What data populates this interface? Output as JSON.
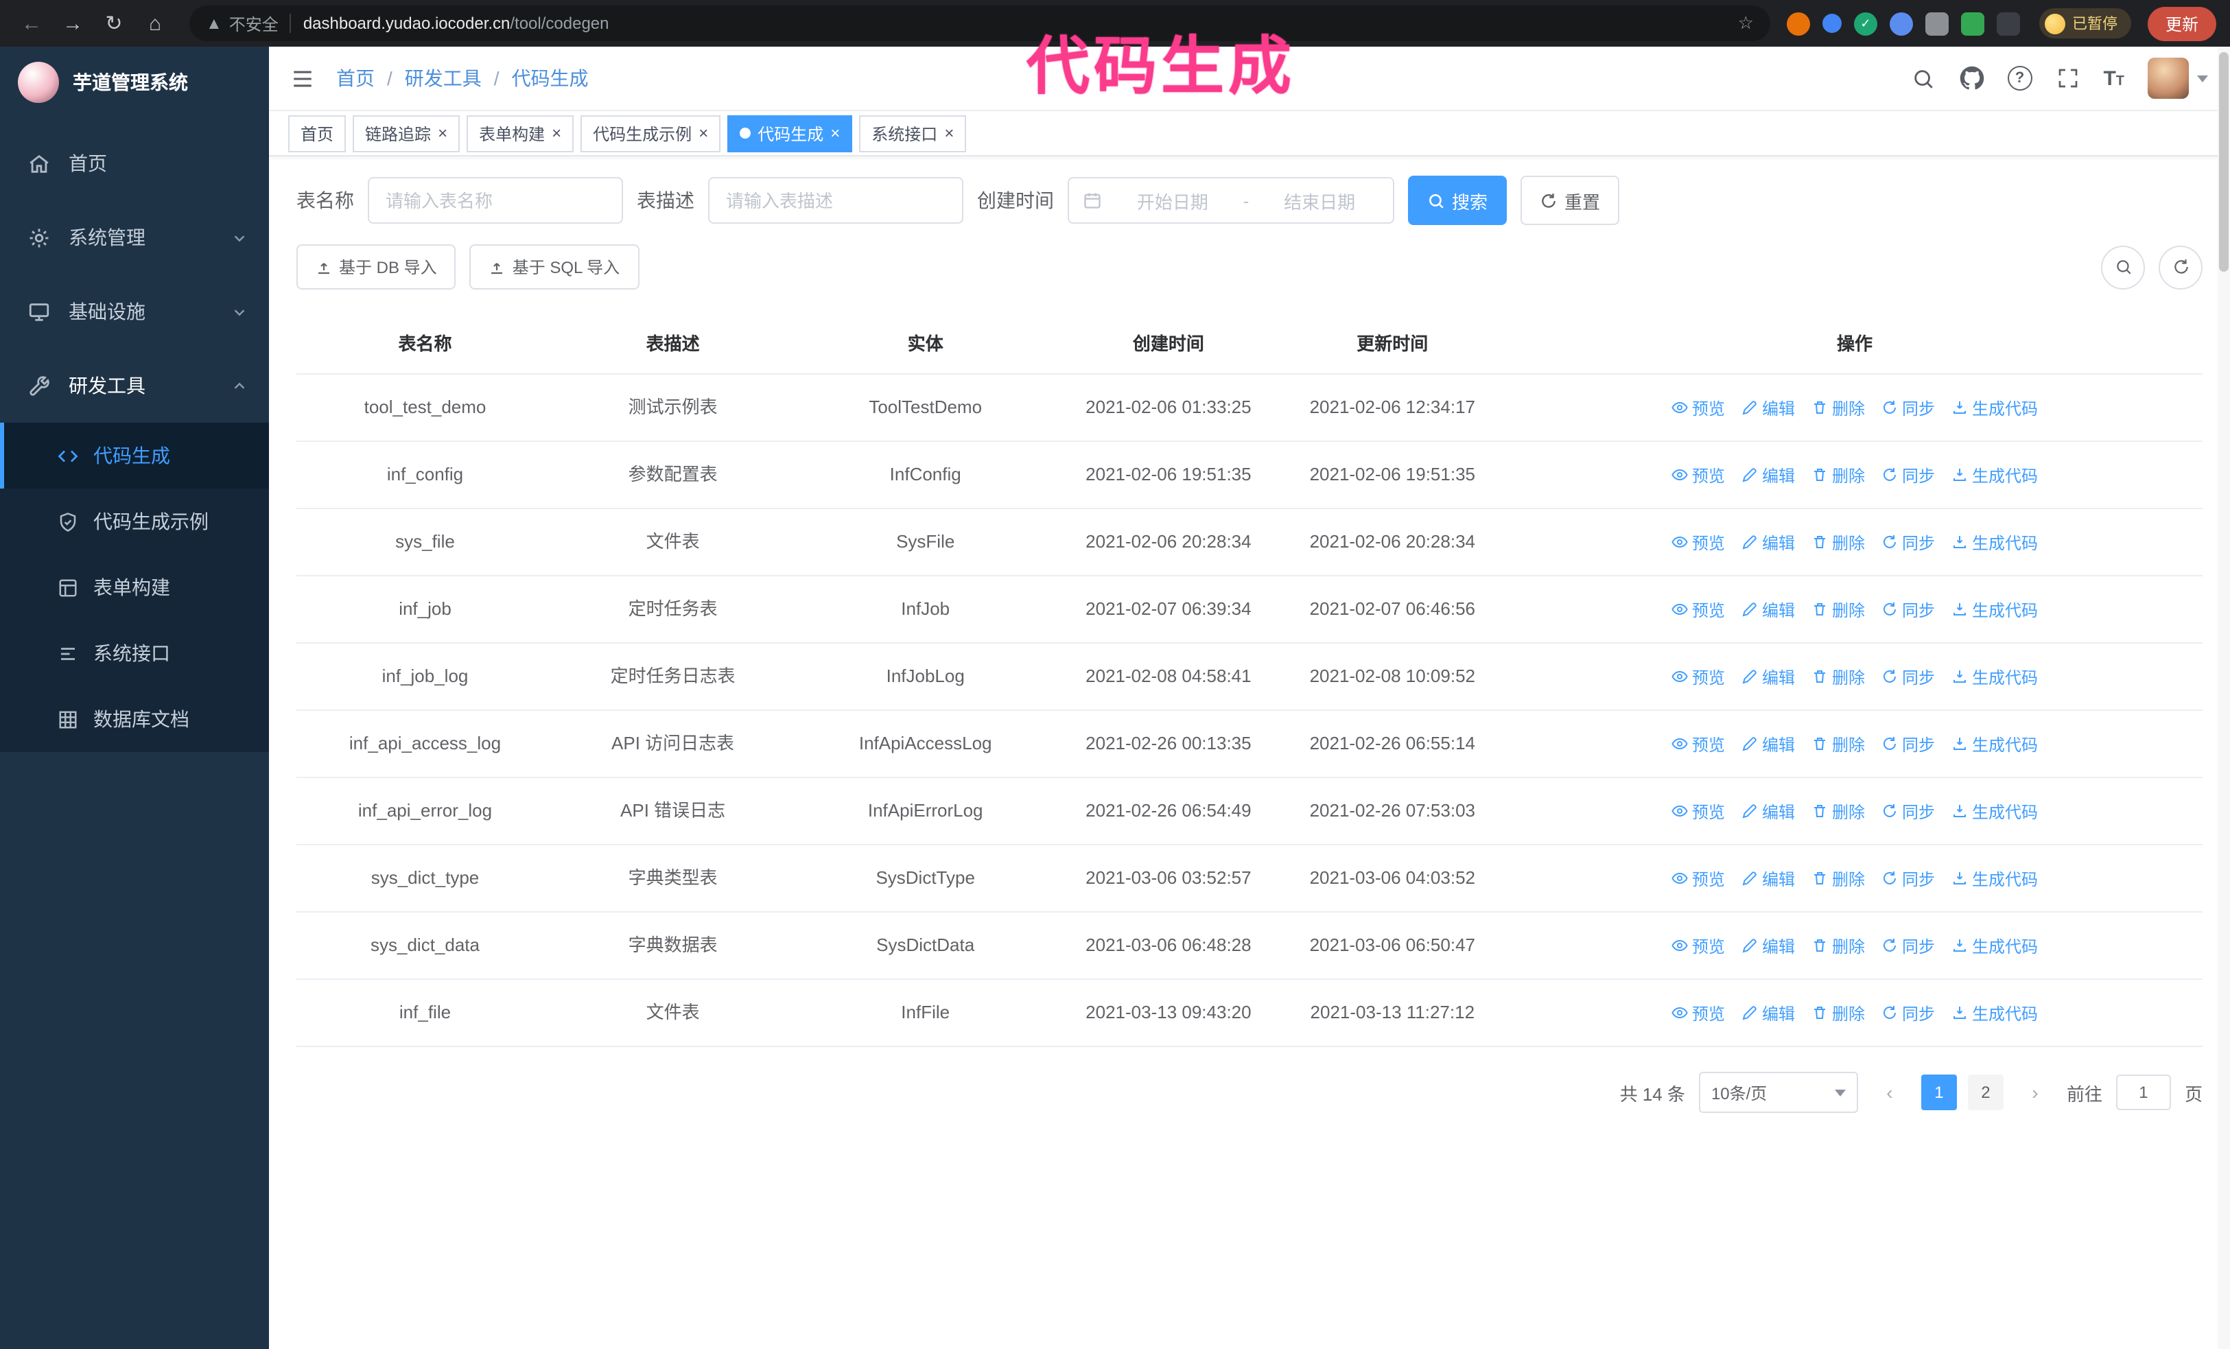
{
  "theme": {
    "accent": "#409eff",
    "sidebar_bg": "#1f3347",
    "submenu_bg": "#152638",
    "annotation_pink": "#fb3b8c"
  },
  "browser": {
    "security_label": "不安全",
    "url_host": "dashboard.yudao.iocoder.cn",
    "url_path": "/tool/codegen",
    "paused_badge": "已暂停",
    "update_button": "更新",
    "extensions": [
      "fox",
      "drop",
      "check",
      "people",
      "camera",
      "leaf",
      "puzzle"
    ]
  },
  "annotation": {
    "title": "代码生成",
    "color": "#fb3b8c"
  },
  "sidebar": {
    "logo_title": "芋道管理系统",
    "items": [
      {
        "label": "首页",
        "icon": "home-icon"
      },
      {
        "label": "系统管理",
        "icon": "gear-icon"
      },
      {
        "label": "基础设施",
        "icon": "monitor-icon"
      },
      {
        "label": "研发工具",
        "icon": "wrench-icon"
      }
    ],
    "sub_items": [
      {
        "label": "代码生成",
        "icon": "code-icon",
        "active": true
      },
      {
        "label": "代码生成示例",
        "icon": "shield-icon"
      },
      {
        "label": "表单构建",
        "icon": "form-icon"
      },
      {
        "label": "系统接口",
        "icon": "list-icon"
      },
      {
        "label": "数据库文档",
        "icon": "grid-icon"
      }
    ]
  },
  "breadcrumb": {
    "items": [
      "首页",
      "研发工具",
      "代码生成"
    ],
    "separator": "/"
  },
  "navbar_icons": [
    "search",
    "github",
    "help",
    "fullscreen",
    "font-size",
    "avatar"
  ],
  "tags": [
    {
      "label": "首页",
      "closable": false,
      "active": false
    },
    {
      "label": "链路追踪",
      "closable": true,
      "active": false
    },
    {
      "label": "表单构建",
      "closable": true,
      "active": false
    },
    {
      "label": "代码生成示例",
      "closable": true,
      "active": false
    },
    {
      "label": "代码生成",
      "closable": true,
      "active": true
    },
    {
      "label": "系统接口",
      "closable": true,
      "active": false
    }
  ],
  "filters": {
    "table_name_label": "表名称",
    "table_name_placeholder": "请输入表名称",
    "table_desc_label": "表描述",
    "table_desc_placeholder": "请输入表描述",
    "create_time_label": "创建时间",
    "date_start_placeholder": "开始日期",
    "date_separator": "-",
    "date_end_placeholder": "结束日期",
    "search_button": "搜索",
    "reset_button": "重置"
  },
  "toolbar": {
    "import_db_button": "基于 DB 导入",
    "import_sql_button": "基于 SQL 导入"
  },
  "table": {
    "columns": [
      "表名称",
      "表描述",
      "实体",
      "创建时间",
      "更新时间",
      "操作"
    ],
    "actions": [
      {
        "label": "预览"
      },
      {
        "label": "编辑"
      },
      {
        "label": "删除"
      },
      {
        "label": "同步"
      },
      {
        "label": "生成代码"
      }
    ],
    "rows": [
      {
        "name": "tool_test_demo",
        "desc": "测试示例表",
        "entity": "ToolTestDemo",
        "created": "2021-02-06 01:33:25",
        "updated": "2021-02-06 12:34:17"
      },
      {
        "name": "inf_config",
        "desc": "参数配置表",
        "entity": "InfConfig",
        "created": "2021-02-06 19:51:35",
        "updated": "2021-02-06 19:51:35"
      },
      {
        "name": "sys_file",
        "desc": "文件表",
        "entity": "SysFile",
        "created": "2021-02-06 20:28:34",
        "updated": "2021-02-06 20:28:34"
      },
      {
        "name": "inf_job",
        "desc": "定时任务表",
        "entity": "InfJob",
        "created": "2021-02-07 06:39:34",
        "updated": "2021-02-07 06:46:56"
      },
      {
        "name": "inf_job_log",
        "desc": "定时任务日志表",
        "entity": "InfJobLog",
        "created": "2021-02-08 04:58:41",
        "updated": "2021-02-08 10:09:52"
      },
      {
        "name": "inf_api_access_log",
        "desc": "API 访问日志表",
        "entity": "InfApiAccessLog",
        "created": "2021-02-26 00:13:35",
        "updated": "2021-02-26 06:55:14"
      },
      {
        "name": "inf_api_error_log",
        "desc": "API 错误日志",
        "entity": "InfApiErrorLog",
        "created": "2021-02-26 06:54:49",
        "updated": "2021-02-26 07:53:03"
      },
      {
        "name": "sys_dict_type",
        "desc": "字典类型表",
        "entity": "SysDictType",
        "created": "2021-03-06 03:52:57",
        "updated": "2021-03-06 04:03:52"
      },
      {
        "name": "sys_dict_data",
        "desc": "字典数据表",
        "entity": "SysDictData",
        "created": "2021-03-06 06:48:28",
        "updated": "2021-03-06 06:50:47"
      },
      {
        "name": "inf_file",
        "desc": "文件表",
        "entity": "InfFile",
        "created": "2021-03-13 09:43:20",
        "updated": "2021-03-13 11:27:12"
      }
    ]
  },
  "pagination": {
    "total_text": "共 14 条",
    "page_size_text": "10条/页",
    "pages": [
      {
        "label": "1",
        "active": true
      },
      {
        "label": "2",
        "active": false
      }
    ],
    "goto_prefix": "前往",
    "goto_value": "1",
    "goto_suffix": "页"
  }
}
